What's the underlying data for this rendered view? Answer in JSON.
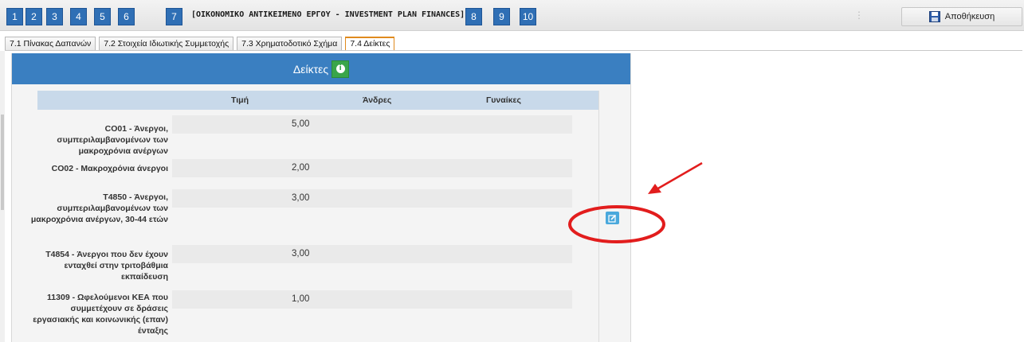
{
  "steps": {
    "before": [
      "1",
      "2",
      "3",
      "4",
      "5",
      "6",
      "7"
    ],
    "current_title": "[ΟΙΚΟΝΟΜΙΚΟ ΑΝΤΙΚΕΙΜΕΝΟ ΕΡΓΟΥ - INVESTMENT PLAN FINANCES]",
    "after": [
      "8",
      "9",
      "10"
    ]
  },
  "toolbar": {
    "separator": "⋮",
    "save_label": "Αποθήκευση",
    "save_icon": "floppy-disk-icon"
  },
  "tabs": [
    {
      "label": "7.1 Πίνακας Δαπανών",
      "active": false
    },
    {
      "label": "7.2 Στοιχεία Ιδιωτικής Συμμετοχής",
      "active": false
    },
    {
      "label": "7.3 Χρηματοδοτικό Σχήμα",
      "active": false
    },
    {
      "label": "7.4 Δείκτες",
      "active": true
    }
  ],
  "panel": {
    "title": "Δείκτες",
    "info_icon": "info-icon",
    "columns": [
      "Τιμή",
      "Άνδρες",
      "Γυναίκες"
    ],
    "rows": [
      {
        "label": "CO01 - Άνεργοι, συμπεριλαμβανομένων των μακροχρόνια ανέργων",
        "value": "5,00"
      },
      {
        "label": "CO02 - Μακροχρόνια άνεργοι",
        "value": "2,00"
      },
      {
        "label": "T4850 - Άνεργοι, συμπεριλαμβανομένων των μακροχρόνια ανέργων, 30-44 ετών",
        "value": "3,00"
      },
      {
        "label": "T4854 - Άνεργοι που δεν έχουν ενταχθεί στην τριτοβάθμια εκπαίδευση",
        "value": "3,00"
      },
      {
        "label": "11309 - Ωφελούμενοι ΚΕΑ που συμμετέχουν σε δράσεις εργασιακής και κοινωνικής (επαν) ένταξης",
        "value": "1,00"
      }
    ],
    "edit_icon": "edit-icon"
  },
  "annotation": {
    "color": "#e21d1d",
    "shapes": [
      "red-arrow",
      "red-ellipse"
    ]
  },
  "colors": {
    "step_blue": "#2f6fb5",
    "header_blue": "#3a7fc1",
    "info_green": "#3aa54a",
    "edit_blue": "#4aa8dc",
    "active_tab_border": "#e08a1e"
  }
}
